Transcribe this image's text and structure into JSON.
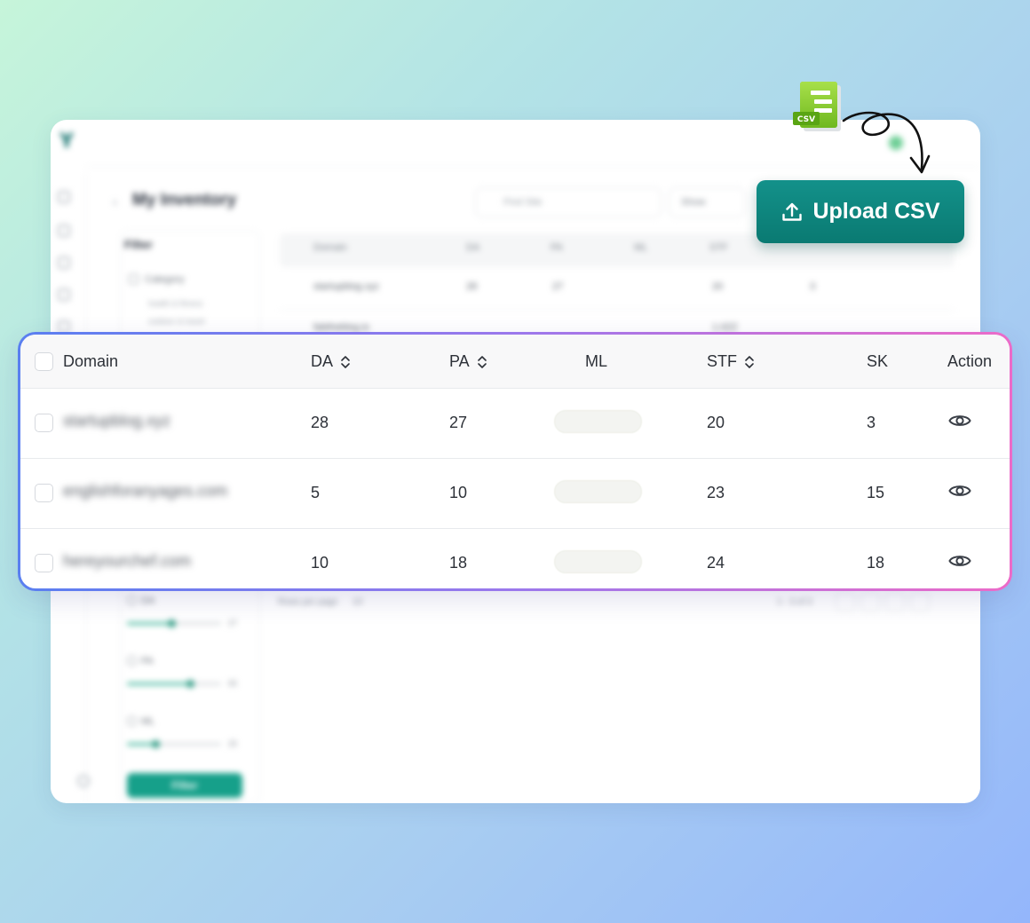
{
  "background_window": {
    "title": "My Inventory",
    "search_placeholder": "Find Site",
    "show_label": "Show",
    "filter_title": "Filter",
    "category_label": "Category",
    "subcategories": [
      "health & fitness",
      "outdoor & travel"
    ],
    "table_headers": [
      "Domain",
      "DA",
      "PA",
      "ML",
      "STF",
      "SK",
      "Action"
    ],
    "preview_rows": [
      {
        "domain": "startupblog.xyz",
        "da": "28",
        "pa": "27",
        "stf": "20",
        "sk": "3"
      },
      {
        "domain": "fabtheblog.io",
        "stf": "1.0ZZ"
      }
    ],
    "sliders": [
      {
        "label": "DA",
        "max": "27",
        "fill": 0.47
      },
      {
        "label": "PA",
        "max": "65",
        "fill": 0.67
      },
      {
        "label": "ML",
        "max": "25",
        "fill": 0.3
      }
    ],
    "filter_button": "Filter",
    "rows_per_page_label": "Rows per page",
    "rows_per_page_value": "10",
    "pagination_text": "1 - 3 of 3"
  },
  "upload_button": {
    "label": "Upload CSV",
    "icon": "upload-icon"
  },
  "csv_badge": "CSV",
  "table": {
    "headers": {
      "domain": "Domain",
      "da": "DA",
      "pa": "PA",
      "ml": "ML",
      "stf": "STF",
      "sk": "SK",
      "action": "Action"
    },
    "rows": [
      {
        "domain": "startupblog.xyz",
        "da": "28",
        "pa": "27",
        "stf": "20",
        "sk": "3"
      },
      {
        "domain": "englishforanyages.com",
        "da": "5",
        "pa": "10",
        "stf": "23",
        "sk": "15"
      },
      {
        "domain": "hereyourchef.com",
        "da": "10",
        "pa": "18",
        "stf": "24",
        "sk": "18"
      }
    ]
  },
  "colors": {
    "accent": "#0f847d",
    "highlight_border_start": "#5a7ff0",
    "highlight_border_end": "#ec6bc8"
  }
}
